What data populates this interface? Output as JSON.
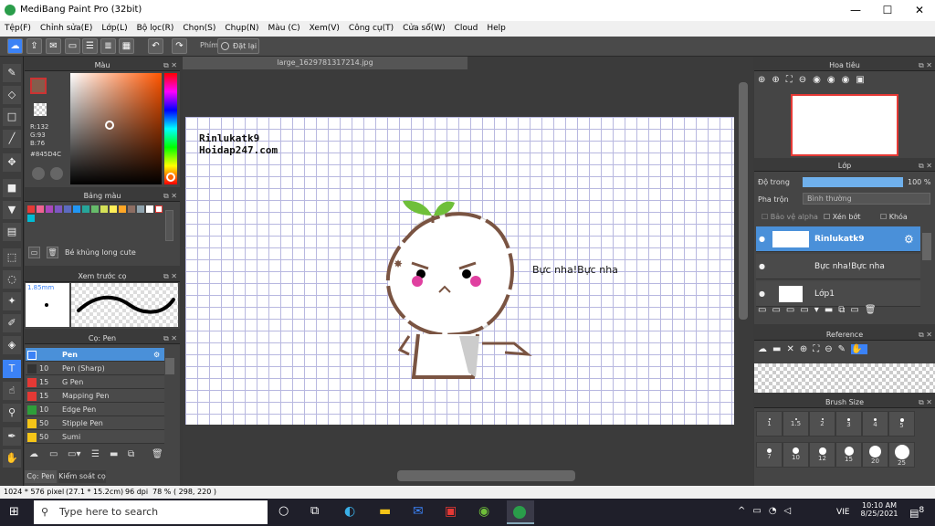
{
  "window": {
    "title": "MediBang Paint Pro (32bit)",
    "min": "—",
    "max": "☐",
    "close": "✕"
  },
  "menu": [
    "Tệp(F)",
    "Chỉnh sửa(E)",
    "Lớp(L)",
    "Bộ lọc(R)",
    "Chọn(S)",
    "Chụp(N)",
    "Màu (C)",
    "Xem(V)",
    "Công cụ(T)",
    "Cửa sổ(W)",
    "Cloud",
    "Help"
  ],
  "toolbar": {
    "key_label": "Phím",
    "reset_label": "Đặt lại"
  },
  "color_panel": {
    "title": "Màu",
    "r": "R:132",
    "g": "G:93",
    "b": "B:76",
    "hex": "#845D4C"
  },
  "palette_panel": {
    "title": "Bảng màu",
    "name": "Bé khủng long cute"
  },
  "brush_preview": {
    "title": "Xem trước cọ",
    "size": "1.85mm"
  },
  "pen_panel": {
    "title": "Cọ: Pen",
    "items": [
      {
        "size": "",
        "name": "Pen",
        "color": "#3b82f6"
      },
      {
        "size": "10",
        "name": "Pen (Sharp)",
        "color": "#333333"
      },
      {
        "size": "15",
        "name": "G Pen",
        "color": "#e53935"
      },
      {
        "size": "15",
        "name": "Mapping Pen",
        "color": "#e53935"
      },
      {
        "size": "10",
        "name": "Edge Pen",
        "color": "#2e9e3a"
      },
      {
        "size": "50",
        "name": "Stipple Pen",
        "color": "#f5c518"
      },
      {
        "size": "50",
        "name": "Sumi",
        "color": "#f5c518"
      }
    ],
    "tab1": "Cọ: Pen",
    "tab2": "Kiểm soát cọ"
  },
  "document": {
    "tab": "large_1629781317214.jpg",
    "wm1": "Rinlukatk9",
    "wm2": "Hoidap247.com",
    "caption": "Bực nha!Bực nha"
  },
  "navigator": {
    "title": "Hoa tiêu"
  },
  "layer_panel": {
    "title": "Lớp",
    "opacity_label": "Độ trong",
    "opacity_value": "100 %",
    "blend_label": "Pha trộn",
    "blend_value": "Bình thường",
    "protect_alpha": "Bảo vệ alpha",
    "clipping": "Xén bớt",
    "lock": "Khóa",
    "layers": [
      {
        "name": "Rinlukatk9"
      },
      {
        "name": "Bực nha!Bực nha"
      },
      {
        "name": "Lớp1"
      }
    ]
  },
  "reference": {
    "title": "Reference"
  },
  "brush_size": {
    "title": "Brush Size",
    "sizes": [
      "1",
      "1.5",
      "2",
      "3",
      "4",
      "5",
      "7",
      "10",
      "12",
      "15",
      "20",
      "25"
    ]
  },
  "status": {
    "size": "1024 * 576 pixel",
    "cm": "(27.1 * 15.2cm)",
    "dpi": "96 dpi",
    "zoom": "78 %",
    "coord": "( 298, 220 )"
  },
  "taskbar": {
    "search": "Type here to search",
    "time": "10:10 AM",
    "date": "8/25/2021",
    "lang": "VIE",
    "notif": "8"
  }
}
